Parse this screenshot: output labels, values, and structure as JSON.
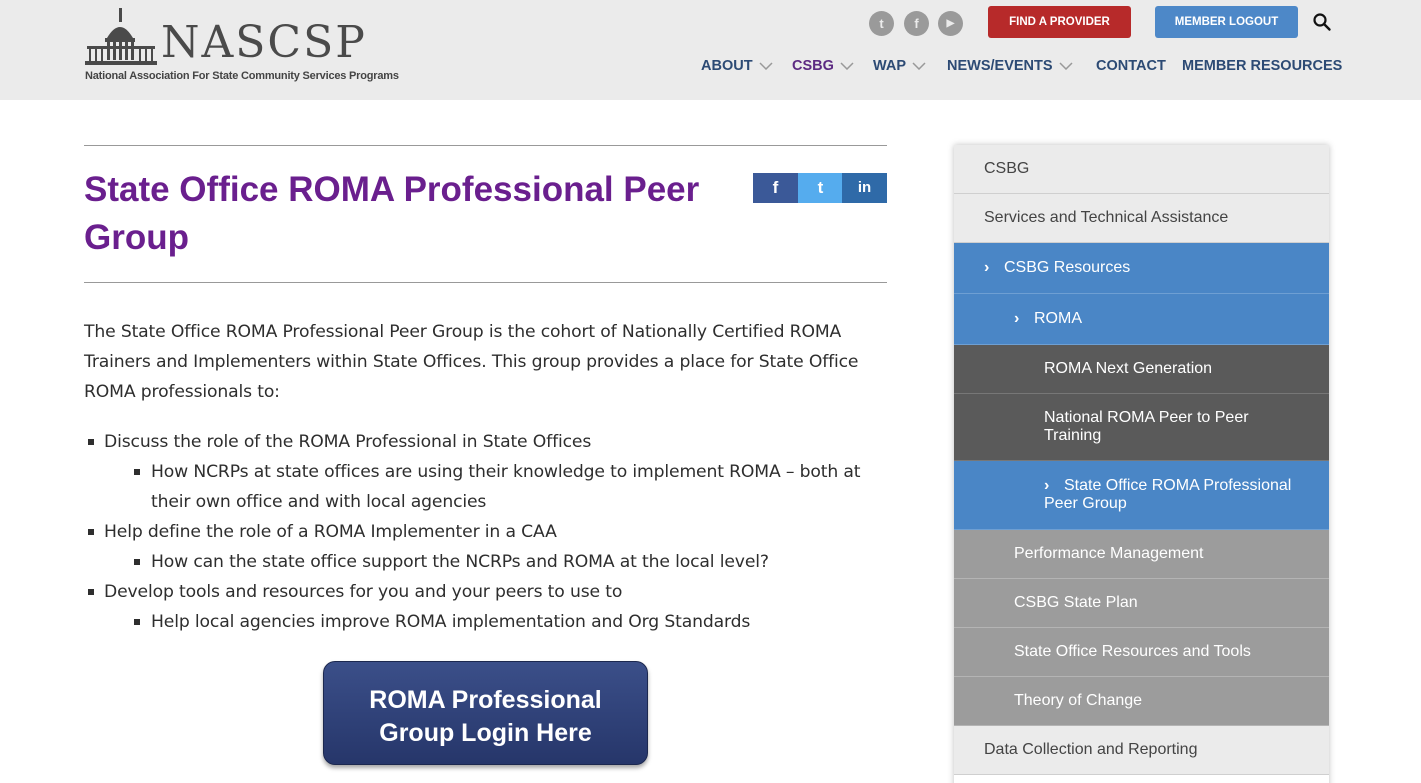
{
  "brand": {
    "name": "NASCSP",
    "tagline": "National Association For State Community Services Programs"
  },
  "header": {
    "social": [
      {
        "icon": "twitter-icon",
        "glyph": "t"
      },
      {
        "icon": "facebook-icon",
        "glyph": "f"
      },
      {
        "icon": "youtube-icon",
        "glyph": "▶"
      }
    ],
    "find_provider": "FIND A PROVIDER",
    "member_logout": "MEMBER LOGOUT",
    "search_icon": "search-icon"
  },
  "nav": {
    "items": [
      {
        "label": "ABOUT",
        "dropdown": true,
        "active": false
      },
      {
        "label": "CSBG",
        "dropdown": true,
        "active": true
      },
      {
        "label": "WAP",
        "dropdown": true,
        "active": false
      },
      {
        "label": "NEWS/EVENTS",
        "dropdown": true,
        "active": false
      },
      {
        "label": "CONTACT",
        "dropdown": false,
        "active": false
      },
      {
        "label": "MEMBER RESOURCES",
        "dropdown": false,
        "active": false
      }
    ]
  },
  "page": {
    "title_line1": "State Office ROMA Professional Peer",
    "title_line2": "Group",
    "share": [
      {
        "icon": "facebook-share-icon",
        "glyph": "f",
        "color": "#3b5998"
      },
      {
        "icon": "twitter-share-icon",
        "glyph": "t",
        "color": "#55acee"
      },
      {
        "icon": "linkedin-share-icon",
        "glyph": "in",
        "color": "#2f6aa8"
      }
    ],
    "intro": "The State Office ROMA Professional Peer Group is the cohort of Nationally Certified ROMA Trainers and Implementers within State Offices. This group provides a place for State Office ROMA professionals to:",
    "bullets": [
      {
        "level": 1,
        "text": "Discuss the role of the ROMA Professional in State Offices"
      },
      {
        "level": 2,
        "text": "How NCRPs at state offices are using their knowledge to implement ROMA – both at their own office and with local agencies"
      },
      {
        "level": 1,
        "text": "Help define the role of a ROMA Implementer in a CAA"
      },
      {
        "level": 2,
        "text": "How can the state office support the NCRPs and ROMA at the local level?"
      },
      {
        "level": 1,
        "text": "Develop tools and resources for you and your peers to use to"
      },
      {
        "level": 2,
        "text": "Help local agencies improve ROMA implementation and Org Standards"
      }
    ],
    "login_line1": "ROMA Professional",
    "login_line2": "Group Login Here"
  },
  "sidebar": {
    "items": [
      {
        "label": "CSBG",
        "style": "l0",
        "arrow": false
      },
      {
        "label": "Services and Technical Assistance",
        "style": "l0",
        "arrow": false
      },
      {
        "label": "CSBG Resources",
        "style": "blue",
        "arrow": true
      },
      {
        "label": "ROMA",
        "style": "blue",
        "arrow": true
      },
      {
        "label": "ROMA Next Generation",
        "style": "dark",
        "arrow": false
      },
      {
        "label": "National ROMA Peer to Peer Training",
        "style": "dark",
        "arrow": false
      },
      {
        "label": "State Office ROMA Professional Peer Group",
        "style": "blue",
        "arrow": true
      },
      {
        "label": "Performance Management",
        "style": "grey",
        "arrow": false
      },
      {
        "label": "CSBG State Plan",
        "style": "grey",
        "arrow": false
      },
      {
        "label": "State Office Resources and Tools",
        "style": "grey",
        "arrow": false
      },
      {
        "label": "Theory of Change",
        "style": "grey",
        "arrow": false
      },
      {
        "label": "Data Collection and Reporting",
        "style": "l0",
        "arrow": false
      }
    ]
  }
}
